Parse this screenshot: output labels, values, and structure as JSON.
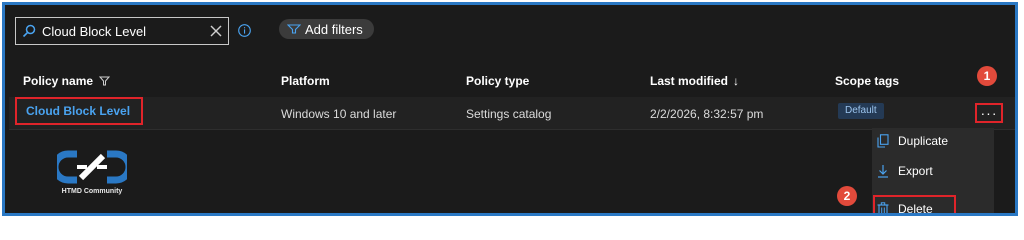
{
  "search": {
    "value": "Cloud Block Level"
  },
  "toolbar": {
    "add_filters_label": "Add filters"
  },
  "table": {
    "columns": {
      "policy_name": "Policy name",
      "platform": "Platform",
      "policy_type": "Policy type",
      "last_modified": "Last modified",
      "last_modified_sort": "↓",
      "scope_tags": "Scope tags"
    },
    "rows": [
      {
        "policy_name": "Cloud Block Level",
        "platform": "Windows 10 and later",
        "policy_type": "Settings catalog",
        "last_modified": "2/2/2026, 8:32:57 pm",
        "scope_tag": "Default"
      }
    ]
  },
  "more_button": "···",
  "context_menu": {
    "items": [
      {
        "label": "Duplicate",
        "icon": "duplicate-icon"
      },
      {
        "label": "Export",
        "icon": "export-icon"
      },
      {
        "label": "Delete",
        "icon": "delete-icon"
      }
    ]
  },
  "annotations": {
    "step1": "1",
    "step2": "2"
  },
  "logo": {
    "text": "HTMD Community"
  },
  "colors": {
    "background": "#1b1b1b",
    "link": "#4aa3f0",
    "highlight_border": "#e0242a",
    "step_badge": "#e24a3b",
    "frame_border": "#2a78c4"
  }
}
